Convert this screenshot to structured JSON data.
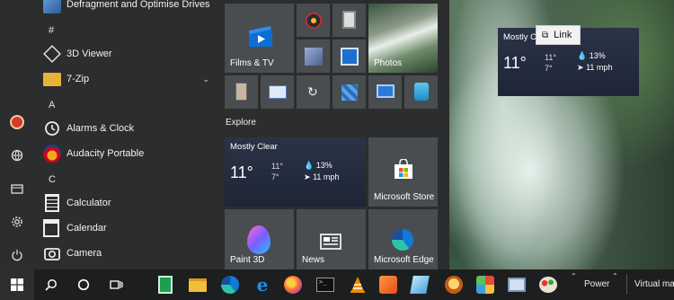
{
  "app_list": {
    "items": [
      {
        "label": "Defragment and Optimise Drives"
      },
      {
        "label": "3D Viewer"
      },
      {
        "label": "7-Zip"
      },
      {
        "label": "Alarms & Clock"
      },
      {
        "label": "Audacity Portable"
      },
      {
        "label": "Calculator"
      },
      {
        "label": "Calendar"
      },
      {
        "label": "Camera"
      }
    ],
    "letters": [
      "#",
      "A",
      "C"
    ],
    "expand_glyph": "⌄"
  },
  "tiles": {
    "films_tv": "Films & TV",
    "photos": "Photos",
    "explore_header": "Explore",
    "microsoft_store": "Microsoft Store",
    "paint3d": "Paint 3D",
    "news": "News",
    "edge": "Microsoft Edge"
  },
  "weather": {
    "condition": "Mostly Clear",
    "temp": "11°",
    "high": "11°",
    "low": "7°",
    "humidity": "13%",
    "wind": "11 mph"
  },
  "desktop_weather": {
    "condition_partial": "Mostly C",
    "temp": "11°",
    "high": "11°",
    "low": "7°",
    "humidity": "13%",
    "wind": "11 mph"
  },
  "tooltip": {
    "label": "Link"
  },
  "taskbar": {
    "power": "Power",
    "virtual": "Virtual ma"
  }
}
